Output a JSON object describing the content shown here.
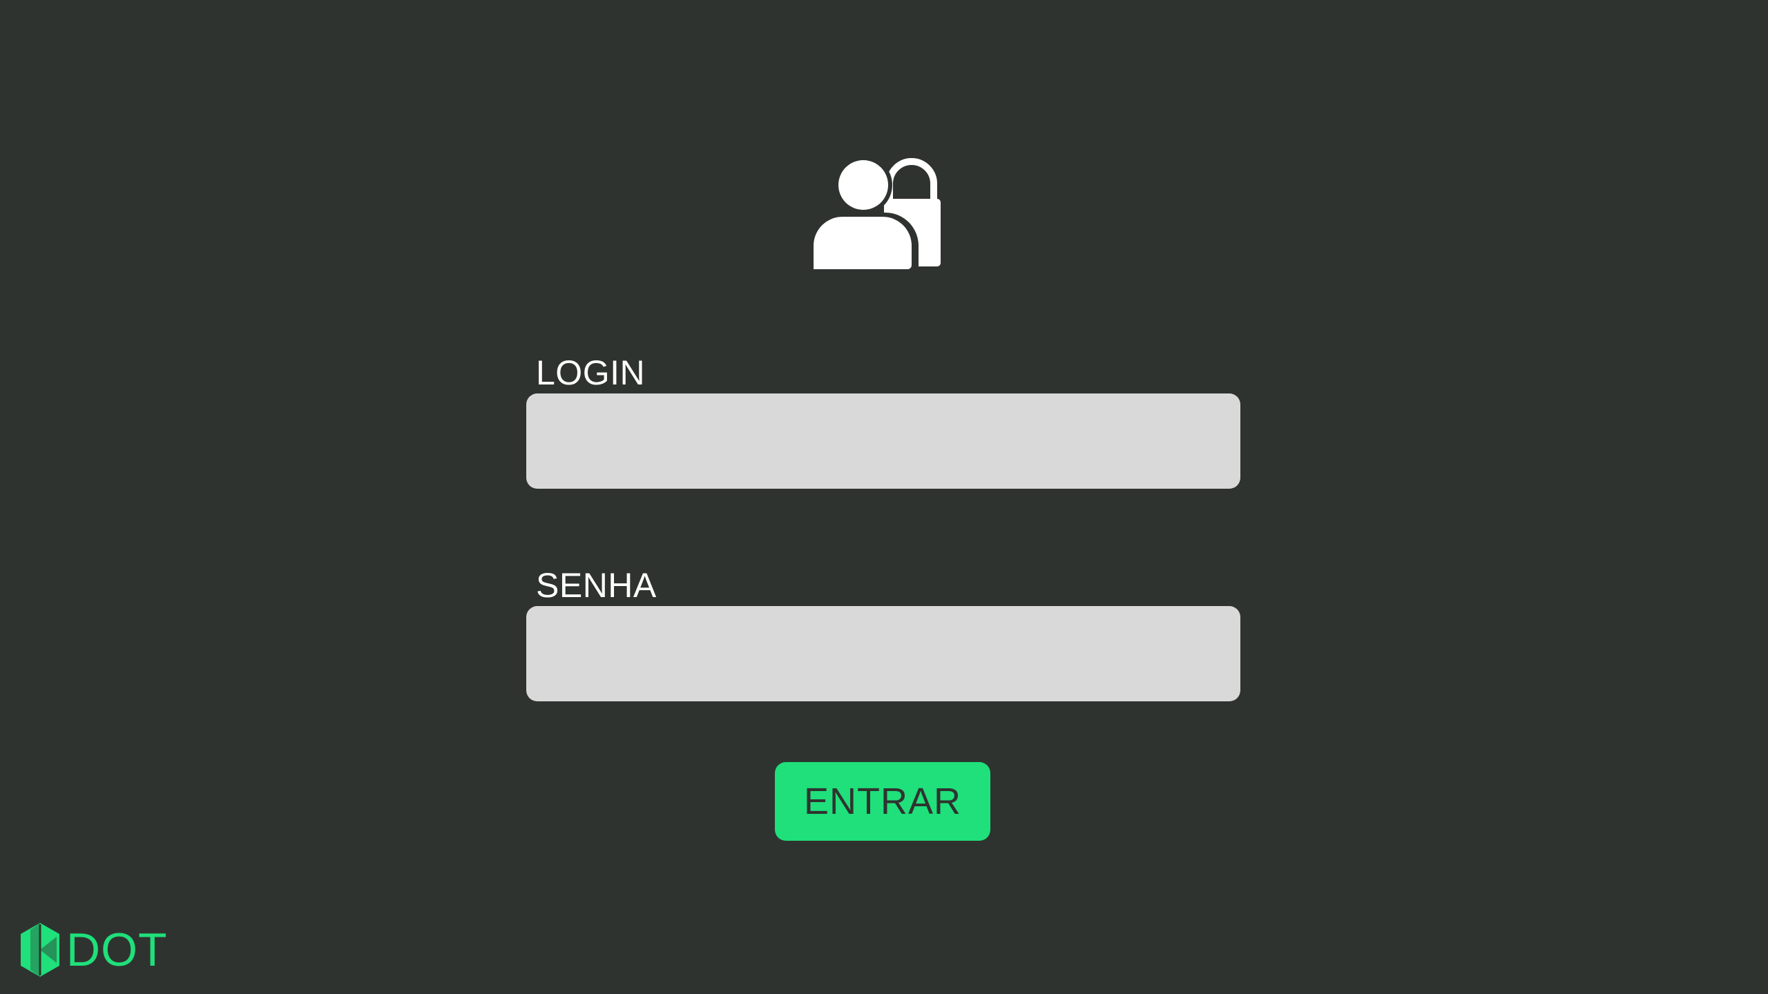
{
  "header": {
    "icon": "user-lock-icon"
  },
  "form": {
    "login_label": "LOGIN",
    "login_value": "",
    "senha_label": "SENHA",
    "senha_value": "",
    "submit_label": "ENTRAR"
  },
  "brand": {
    "name": "DOT",
    "icon": "dot-logo-icon"
  },
  "colors": {
    "background": "#2f3330",
    "accent": "#1fe07a",
    "field_background": "#d9d9d9",
    "text": "#ffffff"
  }
}
